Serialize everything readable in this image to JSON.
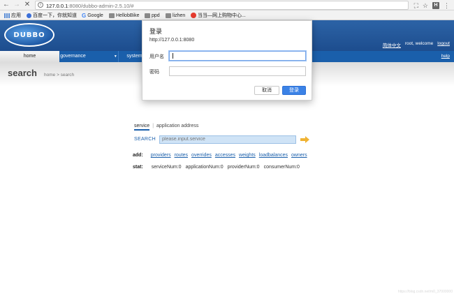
{
  "browser": {
    "url_host": "127.0.0.1",
    "url_rest": ":8080/dubbo-admin-2.5.10/#",
    "bookmarks": [
      "应用",
      "百度一下，你就知道",
      "Google",
      "HellobBike",
      "ppd",
      "lizhen",
      "当当—网上购物中心..."
    ]
  },
  "header": {
    "logo": "DUBBO",
    "lang": "简体中文",
    "user": "root, welcome",
    "logout": "logout"
  },
  "nav": {
    "home": "home",
    "governance": "governance",
    "system": "system",
    "help": "help"
  },
  "page": {
    "title": "search",
    "breadcrumb": "home > search"
  },
  "search": {
    "tab_service": "service",
    "tab_separator": "|",
    "tab_app": "application address",
    "label": "SEARCH",
    "placeholder": "please.input.service"
  },
  "add": {
    "label": "add:",
    "links": [
      "providers",
      "routes",
      "overrides",
      "accesses",
      "weights",
      "loadbalances",
      "owners"
    ]
  },
  "stat": {
    "label": "stat:",
    "items": [
      "serviceNum:0",
      "applicationNum:0",
      "providerNum:0",
      "consumerNum:0"
    ]
  },
  "dialog": {
    "title": "登录",
    "url": "http://127.0.0.1:8080",
    "username_label": "用户名",
    "password_label": "密码",
    "cancel": "取消",
    "login": "登录"
  },
  "watermark": "https://blog.csdn.net/m0_37000000"
}
